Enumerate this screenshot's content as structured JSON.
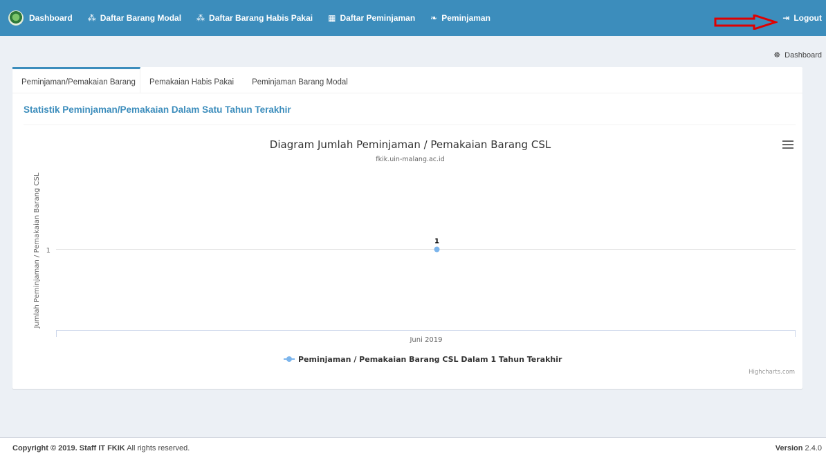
{
  "navbar": {
    "items": [
      {
        "label": "Dashboard",
        "icon": "logo-icon"
      },
      {
        "label": "Daftar Barang Modal",
        "icon": "cubes-icon"
      },
      {
        "label": "Daftar Barang Habis Pakai",
        "icon": "cubes-icon"
      },
      {
        "label": "Daftar Peminjaman",
        "icon": "grid-icon"
      },
      {
        "label": "Peminjaman",
        "icon": "leaf-icon"
      }
    ],
    "logout_label": "Logout",
    "logout_icon": "sign-out-icon"
  },
  "breadcrumb": {
    "label": "Dashboard",
    "icon": "dashboard-icon"
  },
  "tabs": [
    {
      "label": "Peminjaman/Pemakaian Barang",
      "active": true
    },
    {
      "label": "Pemakaian Habis Pakai",
      "active": false
    },
    {
      "label": "Peminjaman Barang Modal",
      "active": false
    }
  ],
  "section": {
    "title": "Statistik Peminjaman/Pemakaian Dalam Satu Tahun Terakhir"
  },
  "chart_data": {
    "type": "line",
    "title": "Diagram Jumlah Peminjaman / Pemakaian Barang CSL",
    "subtitle": "fkik.uin-malang.ac.id",
    "ylabel": "Jumlah Peminjaman / Pemakaian Barang CSL",
    "xlabel": "",
    "categories": [
      "Juni 2019"
    ],
    "series": [
      {
        "name": "Peminjaman / Pemakaian Barang CSL Dalam 1 Tahun Terakhir",
        "values": [
          1
        ],
        "color": "#7cb5ec"
      }
    ],
    "ytick_labels": [
      "1"
    ],
    "data_labels": [
      "1"
    ],
    "grid": true,
    "legend": "bottom-center",
    "credits": "Highcharts.com"
  },
  "footer": {
    "copyright_prefix": "Copyright © 2019.",
    "copyright_owner": "Staff IT FKIK",
    "copyright_suffix": "All rights reserved.",
    "version_label": "Version",
    "version_value": "2.4.0"
  },
  "colors": {
    "primary": "#3c8dbc",
    "series": "#7cb5ec",
    "annotation_arrow": "#e00000"
  }
}
